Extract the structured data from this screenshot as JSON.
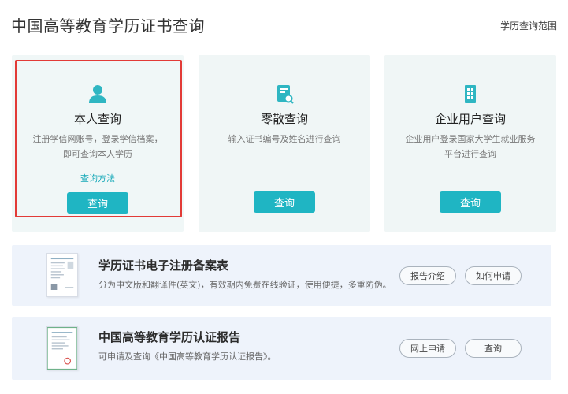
{
  "header": {
    "title": "中国高等教育学历证书查询",
    "scope_link": "学历查询范围"
  },
  "cards": [
    {
      "title": "本人查询",
      "desc": "注册学信网账号，登录学信档案，即可查询本人学历",
      "link": "查询方法",
      "button": "查询",
      "icon": "person-icon"
    },
    {
      "title": "零散查询",
      "desc": "输入证书编号及姓名进行查询",
      "button": "查询",
      "icon": "document-search-icon"
    },
    {
      "title": "企业用户查询",
      "desc": "企业用户登录国家大学生就业服务平台进行查询",
      "button": "查询",
      "icon": "building-icon"
    }
  ],
  "banners": [
    {
      "title": "学历证书电子注册备案表",
      "desc": "分为中文版和翻译件(英文)，有效期内免费在线验证，使用便捷，多重防伪。",
      "buttons": [
        "报告介绍",
        "如何申请"
      ]
    },
    {
      "title": "中国高等教育学历认证报告",
      "desc": "可申请及查询《中国高等教育学历认证报告》。",
      "buttons": [
        "网上申请",
        "查询"
      ]
    }
  ],
  "colors": {
    "accent": "#1fb5c3",
    "highlight": "#e23b37",
    "card_bg": "#f0f6f6",
    "banner_bg": "#eef3fb"
  }
}
